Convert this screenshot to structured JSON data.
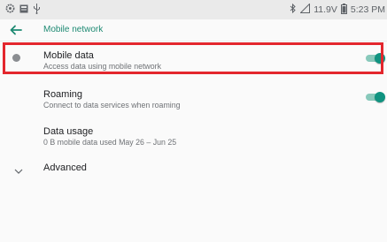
{
  "status_bar": {
    "left_icons": [
      "settings-icon",
      "image-icon",
      "usb-icon"
    ],
    "right_icons": [
      "bluetooth-icon",
      "signal-icon",
      "battery-icon"
    ],
    "voltage": "11.9V",
    "time": "5:23 PM"
  },
  "app_bar": {
    "back_icon": "arrow-left-icon",
    "title": "Mobile network"
  },
  "settings": [
    {
      "title": "Mobile data",
      "subtitle": "Access data using mobile network",
      "toggle_on": true,
      "icon": "dot-icon"
    },
    {
      "title": "Roaming",
      "subtitle": "Connect to data services when roaming",
      "toggle_on": true
    },
    {
      "title": "Data usage",
      "subtitle": "0 B mobile data used May 26 – Jun 25"
    },
    {
      "title": "Advanced",
      "icon": "chevron-down-icon"
    }
  ],
  "colors": {
    "accent": "#1e8a73",
    "toggle_thumb": "#109380",
    "toggle_track": "#88c9bb",
    "highlight": "#e3262d"
  }
}
